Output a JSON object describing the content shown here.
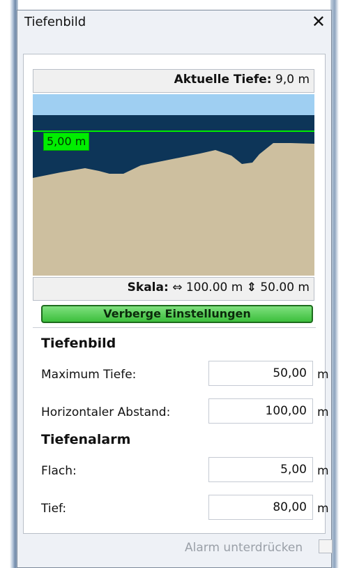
{
  "window": {
    "title": "Tiefenbild",
    "close_glyph": "✕"
  },
  "depth_display": {
    "label": "Aktuelle Tiefe:",
    "value": "9,0 m"
  },
  "sonar": {
    "alarm_line_label": "5,00 m",
    "colors": {
      "sky": "#9fcff2",
      "water": "#0d3558",
      "seabed": "#cdbf9f",
      "alarm_line": "#00ee00"
    }
  },
  "scale": {
    "label": "Skala:",
    "horizontal_icon": "horizontal-arrows-icon",
    "horizontal_value": "100.00 m",
    "vertical_icon": "vertical-arrows-icon",
    "vertical_value": "50.00 m"
  },
  "toggle_settings_button": "Verberge Einstellungen",
  "settings": {
    "depth_image": {
      "heading": "Tiefenbild",
      "max_depth_label": "Maximum Tiefe:",
      "max_depth_value": "50,00",
      "max_depth_unit": "m",
      "h_spacing_label": "Horizontaler Abstand:",
      "h_spacing_value": "100,00",
      "h_spacing_unit": "m"
    },
    "depth_alarm": {
      "heading": "Tiefenalarm",
      "shallow_label": "Flach:",
      "shallow_value": "5,00",
      "shallow_unit": "m",
      "deep_label": "Tief:",
      "deep_value": "80,00",
      "deep_unit": "m"
    }
  },
  "suppress_alarm": {
    "label": "Alarm unterdrücken",
    "checked": false
  }
}
